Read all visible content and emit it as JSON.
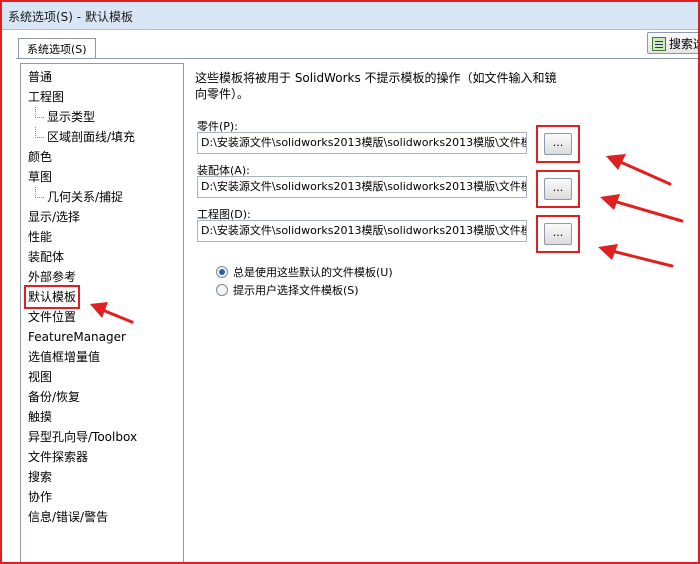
{
  "window": {
    "title": "系统选项(S) - 默认模板"
  },
  "tab": {
    "label": "系统选项(S)"
  },
  "search": {
    "label": "搜索选"
  },
  "nav": {
    "items": [
      {
        "label": "普通",
        "level": 0,
        "selected": false
      },
      {
        "label": "工程图",
        "level": 0,
        "selected": false
      },
      {
        "label": "显示类型",
        "level": 1,
        "selected": false
      },
      {
        "label": "区域剖面线/填充",
        "level": 1,
        "selected": false
      },
      {
        "label": "颜色",
        "level": 0,
        "selected": false
      },
      {
        "label": "草图",
        "level": 0,
        "selected": false
      },
      {
        "label": "几何关系/捕捉",
        "level": 1,
        "selected": false
      },
      {
        "label": "显示/选择",
        "level": 0,
        "selected": false
      },
      {
        "label": "性能",
        "level": 0,
        "selected": false
      },
      {
        "label": "装配体",
        "level": 0,
        "selected": false
      },
      {
        "label": "外部参考",
        "level": 0,
        "selected": false
      },
      {
        "label": "默认模板",
        "level": 0,
        "selected": true
      },
      {
        "label": "文件位置",
        "level": 0,
        "selected": false
      },
      {
        "label": "FeatureManager",
        "level": 0,
        "selected": false
      },
      {
        "label": "选值框增量值",
        "level": 0,
        "selected": false
      },
      {
        "label": "视图",
        "level": 0,
        "selected": false
      },
      {
        "label": "备份/恢复",
        "level": 0,
        "selected": false
      },
      {
        "label": "触摸",
        "level": 0,
        "selected": false
      },
      {
        "label": "异型孔向导/Toolbox",
        "level": 0,
        "selected": false
      },
      {
        "label": "文件探索器",
        "level": 0,
        "selected": false
      },
      {
        "label": "搜索",
        "level": 0,
        "selected": false
      },
      {
        "label": "协作",
        "level": 0,
        "selected": false
      },
      {
        "label": "信息/错误/警告",
        "level": 0,
        "selected": false
      }
    ]
  },
  "main": {
    "description_line1": "这些模板将被用于 SolidWorks 不提示模板的操作（如文件输入和镜",
    "description_line2": "向零件）。",
    "fields": [
      {
        "label": "零件(P):",
        "value": "D:\\安装源文件\\solidworks2013模版\\solidworks2013模版\\文件模",
        "browse_label": "..."
      },
      {
        "label": "装配体(A):",
        "value": "D:\\安装源文件\\solidworks2013模版\\solidworks2013模版\\文件模",
        "browse_label": "..."
      },
      {
        "label": "工程图(D):",
        "value": "D:\\安装源文件\\solidworks2013模版\\solidworks2013模版\\文件模",
        "browse_label": "..."
      }
    ],
    "radio_always": {
      "label": "总是使用这些默认的文件模板(U)",
      "checked": true
    },
    "radio_prompt": {
      "label": "提示用户选择文件模板(S)",
      "checked": false
    }
  },
  "colors": {
    "highlight_red": "#e02020",
    "title_bg": "#d8e6f5",
    "radio_dot": "#2c5fa8"
  }
}
